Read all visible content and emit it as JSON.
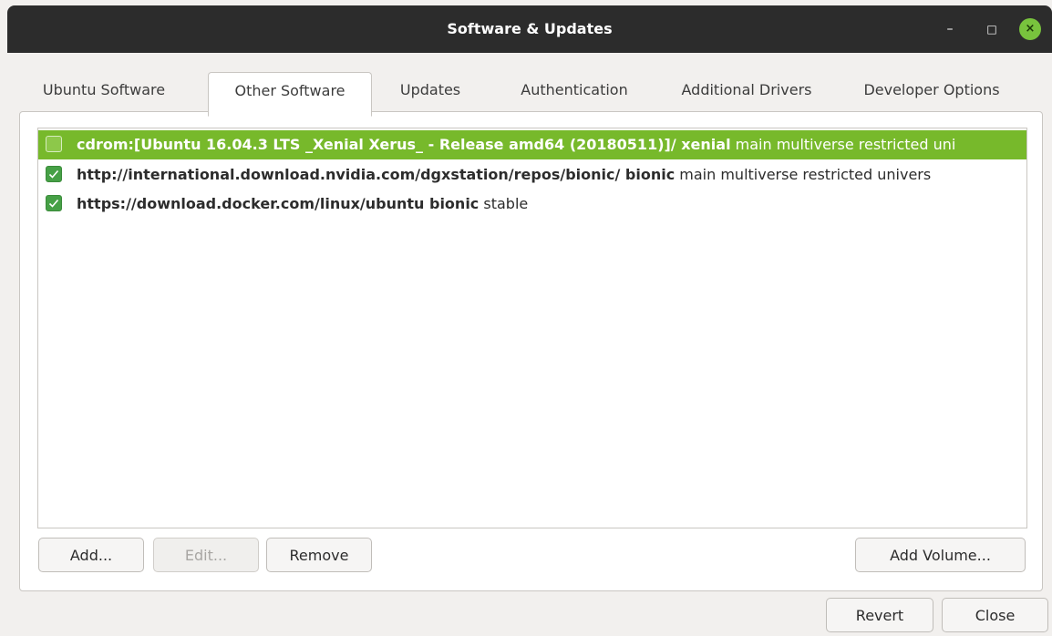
{
  "window": {
    "title": "Software & Updates",
    "buttons": {
      "minimize": "–",
      "maximize": "□",
      "close": "×"
    }
  },
  "tabs": [
    {
      "label": "Ubuntu Software"
    },
    {
      "label": "Other Software",
      "active": true
    },
    {
      "label": "Updates"
    },
    {
      "label": "Authentication"
    },
    {
      "label": "Additional Drivers"
    },
    {
      "label": "Developer Options"
    }
  ],
  "sources": [
    {
      "checked": false,
      "selected": true,
      "uri": "cdrom:[Ubuntu 16.04.3 LTS _Xenial Xerus_ - Release amd64 (20180511)]/ xenial",
      "components": "main multiverse restricted uni"
    },
    {
      "checked": true,
      "selected": false,
      "uri": "http://international.download.nvidia.com/dgxstation/repos/bionic/ bionic",
      "components": "main multiverse restricted univers"
    },
    {
      "checked": true,
      "selected": false,
      "uri": "https://download.docker.com/linux/ubuntu bionic",
      "components": "stable"
    }
  ],
  "list_buttons": {
    "add": "Add...",
    "edit": "Edit...",
    "remove": "Remove",
    "add_volume": "Add Volume..."
  },
  "dialog_buttons": {
    "revert": "Revert",
    "close": "Close"
  },
  "colors": {
    "selection": "#77b92b",
    "checkbox_checked": "#46a046",
    "titlebar": "#2c2c2c",
    "close_button": "#78c33d"
  }
}
